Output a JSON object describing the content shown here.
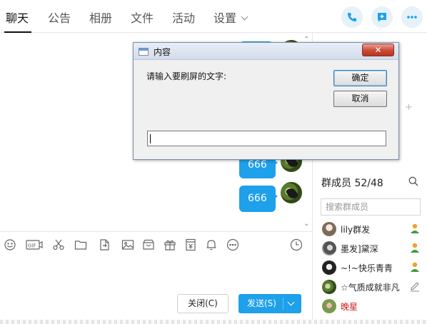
{
  "tabs": [
    {
      "label": "聊天",
      "active": true
    },
    {
      "label": "公告",
      "active": false
    },
    {
      "label": "相册",
      "active": false
    },
    {
      "label": "文件",
      "active": false
    },
    {
      "label": "活动",
      "active": false
    },
    {
      "label": "设置",
      "active": false
    }
  ],
  "top_actions": [
    {
      "icon": "phone-icon"
    },
    {
      "icon": "add-app-icon"
    },
    {
      "icon": "more-icon"
    }
  ],
  "chat": {
    "messages": [
      {
        "text": "666"
      },
      {
        "text": "666"
      }
    ]
  },
  "toolbar": {
    "icons": [
      "emoji-icon",
      "gif-icon",
      "screenshot-icon",
      "folder-icon",
      "file-transfer-icon",
      "image-icon",
      "shop-icon",
      "gift-icon",
      "red-packet-icon",
      "bell-icon",
      "more-icon",
      "history-icon"
    ],
    "gif_label": "GIF"
  },
  "buttons": {
    "close_label": "关闭(C)",
    "send_label": "发送(S)"
  },
  "right_panel": {
    "members_title": "群成员 52/48",
    "search_placeholder": "搜索群成员",
    "members": [
      {
        "name": "lily群发",
        "role": "admin",
        "name_color": "#222222"
      },
      {
        "name": "墨发]黛深",
        "role": "admin",
        "name_color": "#222222"
      },
      {
        "name": "~!~快乐青青",
        "role": "admin",
        "name_color": "#222222"
      },
      {
        "name": "☆气质成就非凡",
        "role": "edit",
        "name_color": "#222222"
      },
      {
        "name": "晚星",
        "role": "none",
        "name_color": "#d21a1a"
      }
    ]
  },
  "dialog": {
    "title": "内容",
    "close_label": "✕",
    "prompt": "请输入要刷屏的文字:",
    "ok_label": "确定",
    "cancel_label": "取消",
    "input_value": ""
  },
  "colors": {
    "accent": "#1ea0ea",
    "tab_active": "#111111",
    "admin_green": "#3a9d3a",
    "admin_orange": "#f0a12e",
    "dialog_close_red": "#c94a35"
  }
}
